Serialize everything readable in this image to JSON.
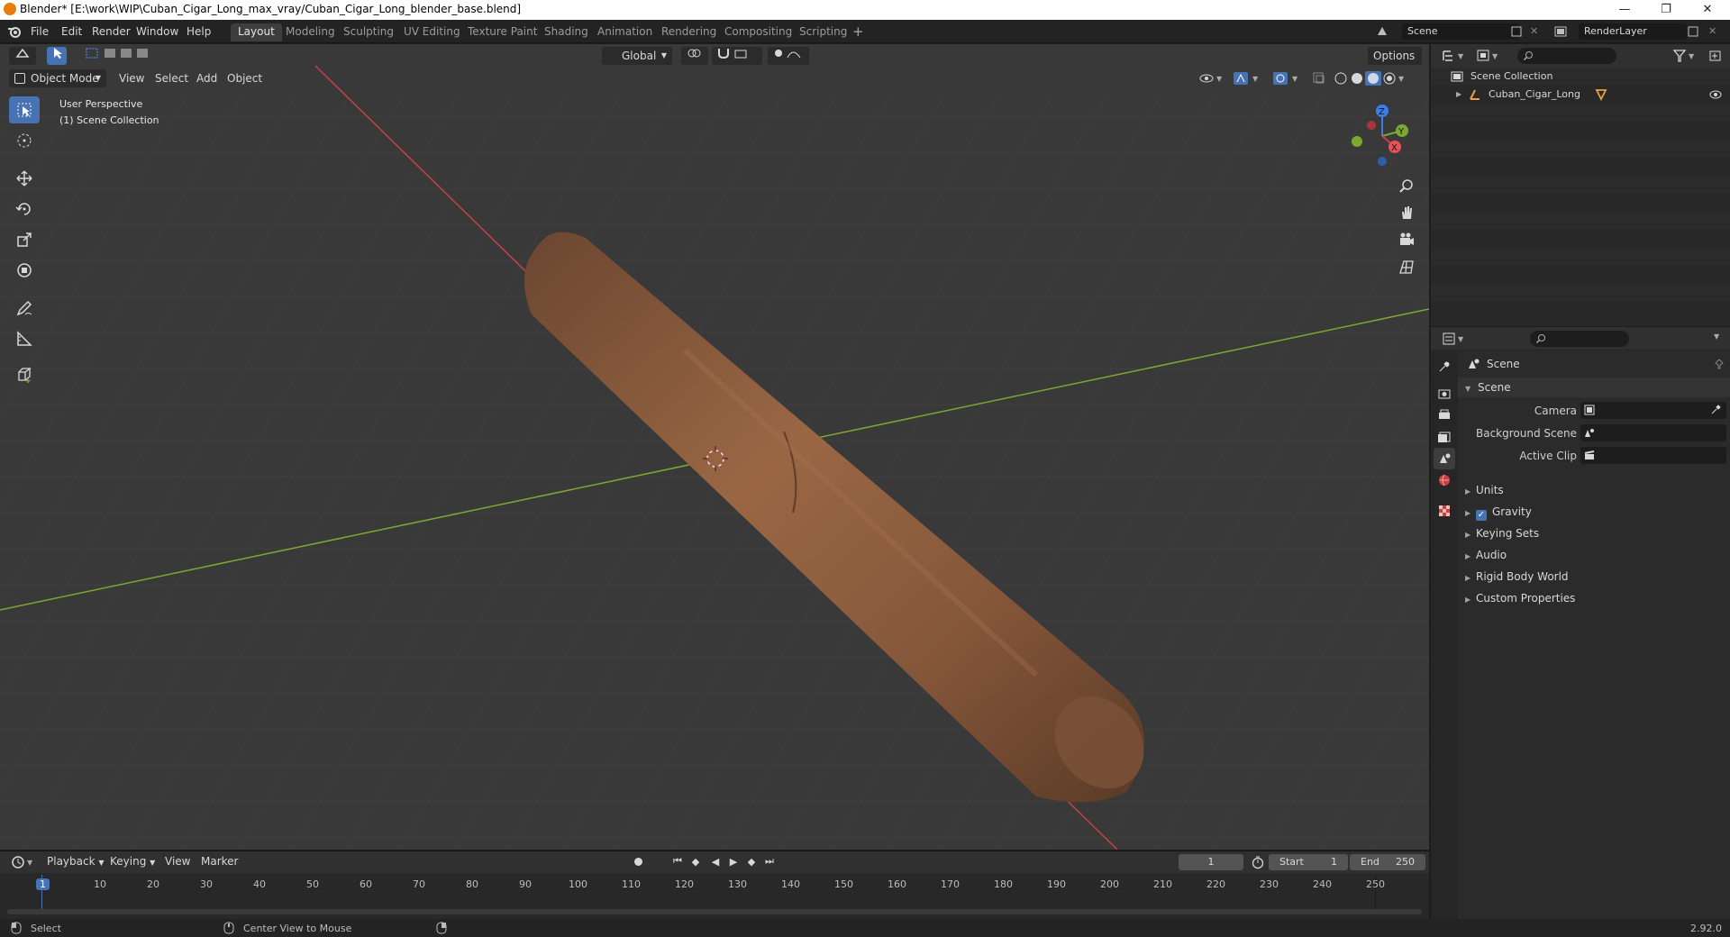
{
  "window": {
    "title": "Blender* [E:\\work\\WIP\\Cuban_Cigar_Long_max_vray/Cuban_Cigar_Long_blender_base.blend]",
    "minimize": "—",
    "restore": "❐",
    "close": "✕"
  },
  "menu": [
    "File",
    "Edit",
    "Render",
    "Window",
    "Help"
  ],
  "workspaces": [
    "Layout",
    "Modeling",
    "Sculpting",
    "UV Editing",
    "Texture Paint",
    "Shading",
    "Animation",
    "Rendering",
    "Compositing",
    "Scripting"
  ],
  "add_workspace": "+",
  "scene_field": "Scene",
  "renderlayer_field": "RenderLayer",
  "viewport": {
    "transform_orientation": "Global",
    "options": "Options",
    "mode": "Object Mode",
    "menus": [
      "View",
      "Select",
      "Add",
      "Object"
    ],
    "perspective_label": "User Perspective",
    "collection_label": "(1) Scene Collection",
    "gizmo": {
      "z": "Z",
      "y": "Y",
      "x": "X"
    }
  },
  "outliner": {
    "root": "Scene Collection",
    "items": [
      {
        "name": "Cuban_Cigar_Long"
      }
    ]
  },
  "properties": {
    "context": "Scene",
    "panel": "Scene",
    "fields": [
      {
        "label": "Camera"
      },
      {
        "label": "Background Scene"
      },
      {
        "label": "Active Clip"
      }
    ],
    "subpanels": [
      {
        "label": "Units",
        "checkbox": false
      },
      {
        "label": "Gravity",
        "checkbox": true
      },
      {
        "label": "Keying Sets",
        "checkbox": false
      },
      {
        "label": "Audio",
        "checkbox": false
      },
      {
        "label": "Rigid Body World",
        "checkbox": false
      },
      {
        "label": "Custom Properties",
        "checkbox": false
      }
    ]
  },
  "timeline": {
    "menus": [
      "Playback",
      "Keying",
      "View",
      "Marker"
    ],
    "current_frame": "1",
    "start_label": "Start",
    "start_value": "1",
    "end_label": "End",
    "end_value": "250",
    "ruler": [
      "1",
      "10",
      "20",
      "30",
      "40",
      "50",
      "60",
      "70",
      "80",
      "90",
      "100",
      "110",
      "120",
      "130",
      "140",
      "150",
      "160",
      "170",
      "180",
      "190",
      "200",
      "210",
      "220",
      "230",
      "240",
      "250"
    ]
  },
  "status": {
    "left_hint": "Select",
    "middle_hint": "Center View to Mouse",
    "version": "2.92.0"
  },
  "colors": {
    "accent": "#4772b3",
    "x_axis": "#c8404a",
    "y_axis": "#7ca832",
    "z_axis": "#3b7de8",
    "cigar": "#8a5a3a"
  }
}
